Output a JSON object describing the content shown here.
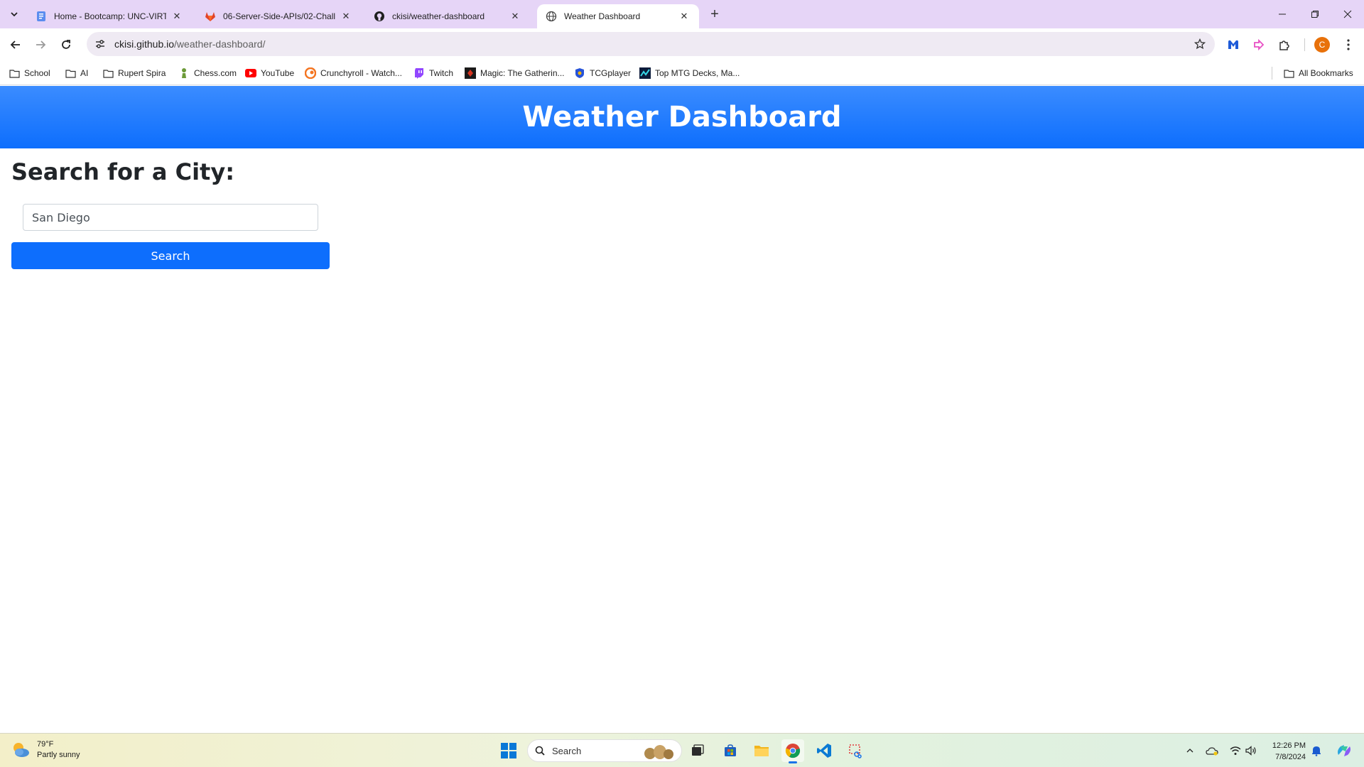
{
  "browser": {
    "tabs": [
      {
        "title": "Home - Bootcamp: UNC-VIRT-F",
        "icon": "canvas-doc-icon",
        "active": false
      },
      {
        "title": "06-Server-Side-APIs/02-Challen",
        "icon": "gitlab-icon",
        "active": false
      },
      {
        "title": "ckisi/weather-dashboard",
        "icon": "github-icon",
        "active": false
      },
      {
        "title": "Weather Dashboard",
        "icon": "globe-icon",
        "active": true
      }
    ],
    "new_tab": "+",
    "url": {
      "host": "ckisi.github.io",
      "path": "/weather-dashboard/"
    },
    "bookmarks": [
      {
        "label": "School",
        "icon": "folder-icon"
      },
      {
        "label": "AI",
        "icon": "folder-icon"
      },
      {
        "label": "Rupert Spira",
        "icon": "folder-icon"
      },
      {
        "label": "Chess.com",
        "icon": "chess-pawn-icon"
      },
      {
        "label": "YouTube",
        "icon": "youtube-icon"
      },
      {
        "label": "Crunchyroll - Watch...",
        "icon": "crunchyroll-icon"
      },
      {
        "label": "Twitch",
        "icon": "twitch-icon"
      },
      {
        "label": "Magic: The Gatherin...",
        "icon": "mtg-icon"
      },
      {
        "label": "TCGplayer",
        "icon": "tcgplayer-icon"
      },
      {
        "label": "Top MTG Decks, Ma...",
        "icon": "mtg-decks-icon"
      }
    ],
    "all_bookmarks": "All Bookmarks",
    "profile_initial": "C"
  },
  "page": {
    "header_title": "Weather Dashboard",
    "search_heading": "Search for a City:",
    "city_input_value": "San Diego",
    "search_button": "Search"
  },
  "taskbar": {
    "weather_temp": "79°F",
    "weather_desc": "Partly sunny",
    "search_placeholder": "Search",
    "time": "12:26 PM",
    "date": "7/8/2024"
  },
  "colors": {
    "tabbar": "#e6d5f7",
    "header": "#0d6efd",
    "button": "#0d6efd"
  }
}
